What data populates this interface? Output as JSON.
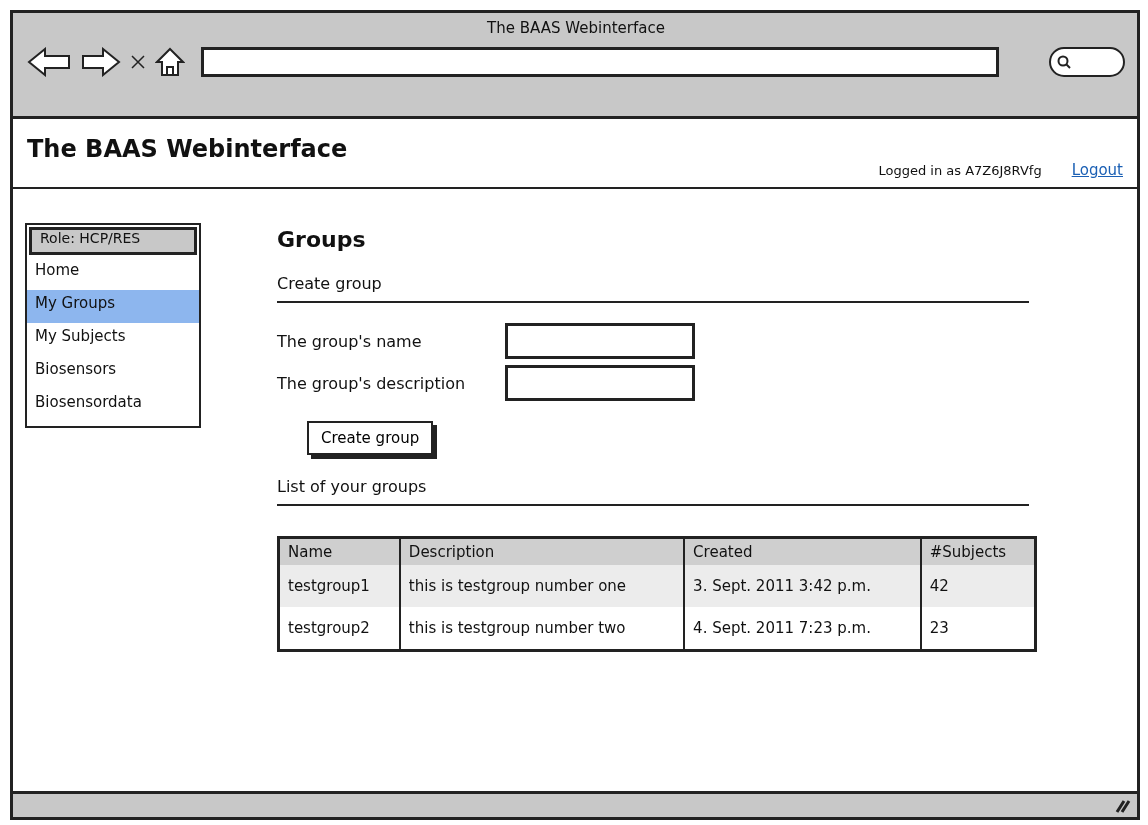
{
  "window": {
    "title": "The BAAS Webinterface"
  },
  "header": {
    "title": "The BAAS Webinterface",
    "user": "Logged in as A7Z6J8RVfg",
    "logout": "Logout"
  },
  "sidebar": {
    "role": "Role: HCP/RES",
    "items": [
      {
        "label": "Home",
        "selected": false
      },
      {
        "label": "My Groups",
        "selected": true
      },
      {
        "label": "My Subjects",
        "selected": false
      },
      {
        "label": "Biosensors",
        "selected": false
      },
      {
        "label": "Biosensordata",
        "selected": false
      }
    ]
  },
  "page": {
    "title": "Groups",
    "create_section": "Create group",
    "fields": [
      {
        "label": "The group's name"
      },
      {
        "label": "The group's description"
      }
    ],
    "create_button": "Create group",
    "list_section": "List of your groups"
  },
  "table": {
    "columns": [
      "Name",
      "Description",
      "Created",
      "#Subjects"
    ],
    "rows": [
      [
        "testgroup1",
        "this is testgroup number one",
        "3. Sept. 2011 3:42 p.m.",
        "42"
      ],
      [
        "testgroup2",
        "this is testgroup number two",
        "4. Sept. 2011 7:23 p.m.",
        "23"
      ]
    ]
  }
}
